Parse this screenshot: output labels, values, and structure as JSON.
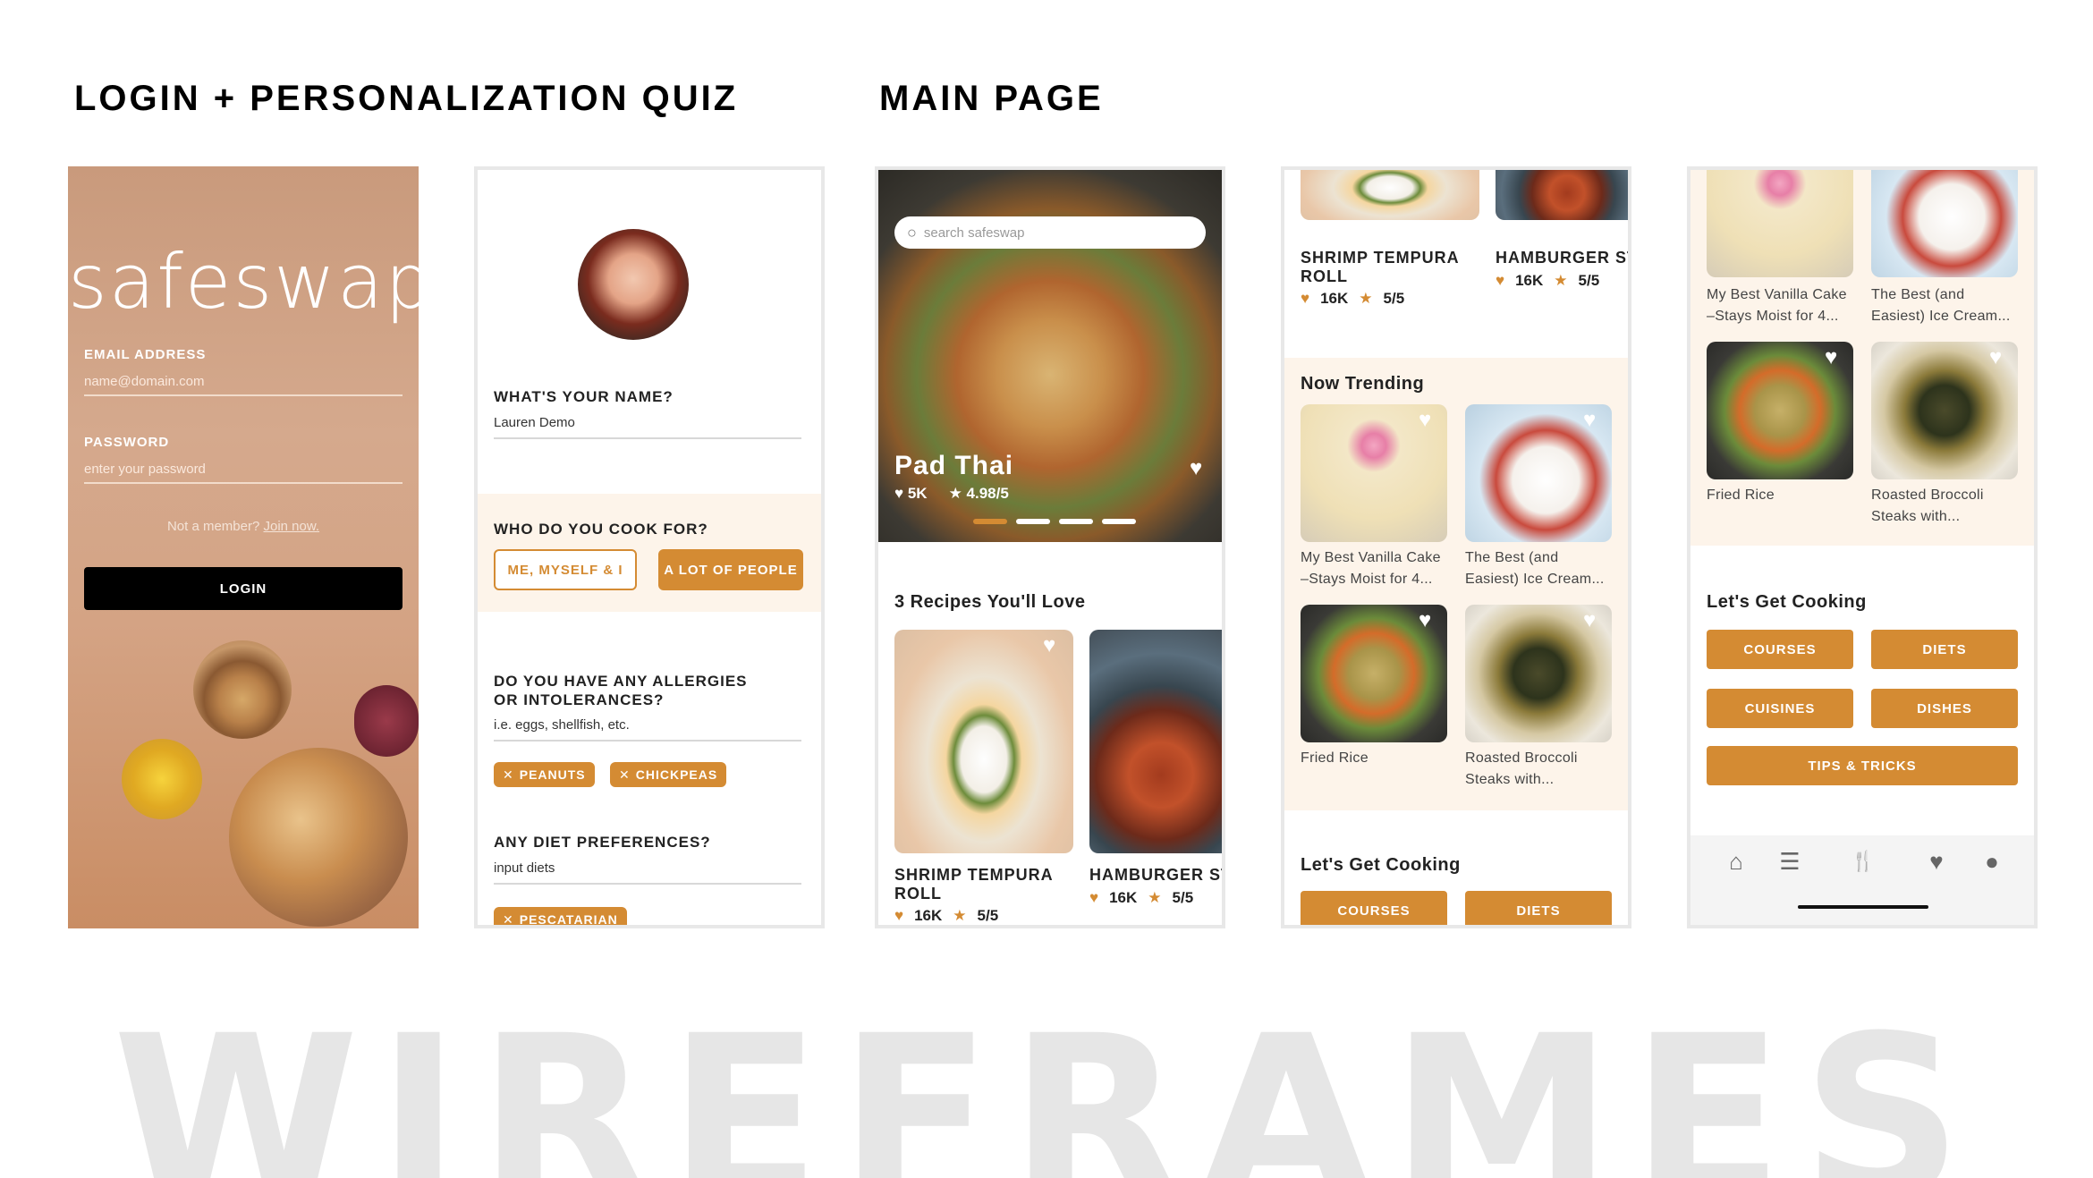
{
  "headings": {
    "login_section": "LOGIN + PERSONALIZATION QUIZ",
    "main_section": "MAIN PAGE",
    "watermark": "WIREFRAMES"
  },
  "login": {
    "logo": "safeswap",
    "email_label": "EMAIL ADDRESS",
    "email_placeholder": "name@domain.com",
    "password_label": "PASSWORD",
    "password_placeholder": "enter your password",
    "not_member": "Not a member?",
    "join_link": "Join now.",
    "login_button": "LOGIN"
  },
  "quiz": {
    "name_question": "WHAT'S YOUR NAME?",
    "name_value": "Lauren Demo",
    "cook_question": "WHO DO YOU COOK FOR?",
    "cook_options": [
      "ME, MYSELF & I",
      "A LOT OF PEOPLE"
    ],
    "allergy_question_1": "DO YOU HAVE ANY ALLERGIES",
    "allergy_question_2": "OR INTOLERANCES?",
    "allergy_placeholder": "i.e. eggs, shellfish, etc.",
    "allergy_chips": [
      "PEANUTS",
      "CHICKPEAS"
    ],
    "diet_question": "ANY DIET PREFERENCES?",
    "diet_placeholder": "input diets",
    "diet_chips": [
      "PESCATARIAN"
    ]
  },
  "main1": {
    "search_placeholder": "search safeswap",
    "hero_title": "Pad Thai",
    "hero_likes": "5K",
    "hero_rating": "4.98/5",
    "section_title": "3 Recipes You'll Love",
    "cards": [
      {
        "title_1": "SHRIMP TEMPURA",
        "title_2": "ROLL",
        "likes": "16K",
        "rating": "5/5"
      },
      {
        "title_1": "HAMBURGER ST",
        "likes": "16K",
        "rating": "5/5"
      }
    ]
  },
  "main2": {
    "cards": [
      {
        "title_1": "SHRIMP TEMPURA",
        "title_2": "ROLL",
        "likes": "16K",
        "rating": "5/5"
      },
      {
        "title_1": "HAMBURGER ST",
        "likes": "16K",
        "rating": "5/5"
      }
    ],
    "trending_title": "Now Trending",
    "trending": [
      {
        "line1": "My Best Vanilla Cake",
        "line2": "–Stays Moist for 4..."
      },
      {
        "line1": "The Best (and",
        "line2": "Easiest) Ice Cream..."
      },
      {
        "line1": "Fried Rice",
        "line2": ""
      },
      {
        "line1": "Roasted Broccoli",
        "line2": "Steaks with..."
      }
    ],
    "cooking_title": "Let's Get Cooking",
    "buttons": [
      "COURSES",
      "DIETS"
    ]
  },
  "main3": {
    "trending": [
      {
        "line1": "My Best Vanilla Cake",
        "line2": "–Stays Moist for 4..."
      },
      {
        "line1": "The Best (and",
        "line2": "Easiest) Ice Cream..."
      },
      {
        "line1": "Fried Rice",
        "line2": ""
      },
      {
        "line1": "Roasted Broccoli",
        "line2": "Steaks with..."
      }
    ],
    "cooking_title": "Let's Get Cooking",
    "buttons": [
      "COURSES",
      "DIETS",
      "CUISINES",
      "DISHES",
      "TIPS & TRICKS"
    ],
    "nav_icons": [
      "home-icon",
      "list-icon",
      "utensils-icon",
      "heart-icon",
      "profile-icon"
    ]
  },
  "glyphs": {
    "heart": "♥",
    "star": "★",
    "close": "✕",
    "home": "⌂",
    "list": "☰",
    "utensils": "🍴",
    "profile": "●"
  },
  "colors": {
    "accent": "#d48b33",
    "band": "#fdf4ea",
    "watermark": "#e6e6e6"
  }
}
